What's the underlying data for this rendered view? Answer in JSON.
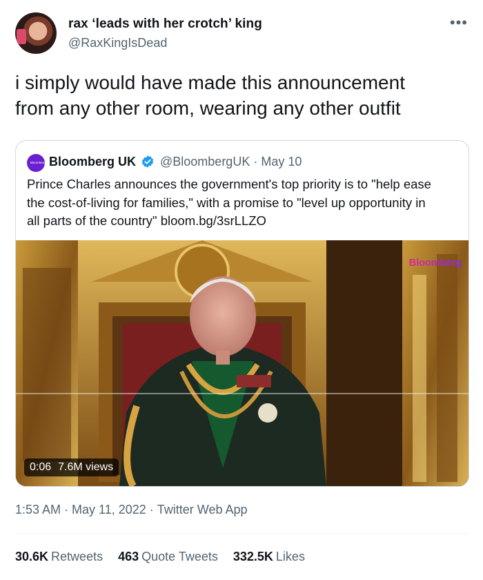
{
  "author": {
    "name": "rax ‘leads with her crotch’ king",
    "handle": "@RaxKingIsDead",
    "more_icon": "more-horizontal-icon"
  },
  "tweet_text": "i simply would have made this announcement\nfrom any other room, wearing any other outfit",
  "quoted": {
    "avatar_text": "Bloomberg UK",
    "name": "Bloomberg UK",
    "verified_icon": "verified-badge-icon",
    "handle": "@BloombergUK",
    "separator": "·",
    "date": "May 10",
    "text": "Prince Charles announces the government's top priority is to \"help ease\nthe cost-of-living for families,\" with a promise to \"level up opportunity in\nall parts of the country\" bloom.bg/3srLLZO",
    "video": {
      "watermark": "Bloomberg",
      "duration": "0:06",
      "views": "7.6M views"
    }
  },
  "meta": {
    "time": "1:53 AM",
    "date": "May 11, 2022",
    "source": "Twitter Web App",
    "separator": "·"
  },
  "stats": {
    "retweets_count": "30.6K",
    "retweets_label": "Retweets",
    "quotes_count": "463",
    "quotes_label": "Quote Tweets",
    "likes_count": "332.5K",
    "likes_label": "Likes"
  },
  "colors": {
    "text": "#0f1419",
    "secondary": "#536471",
    "verified": "#1d9bf0",
    "border": "#cfd9de"
  }
}
